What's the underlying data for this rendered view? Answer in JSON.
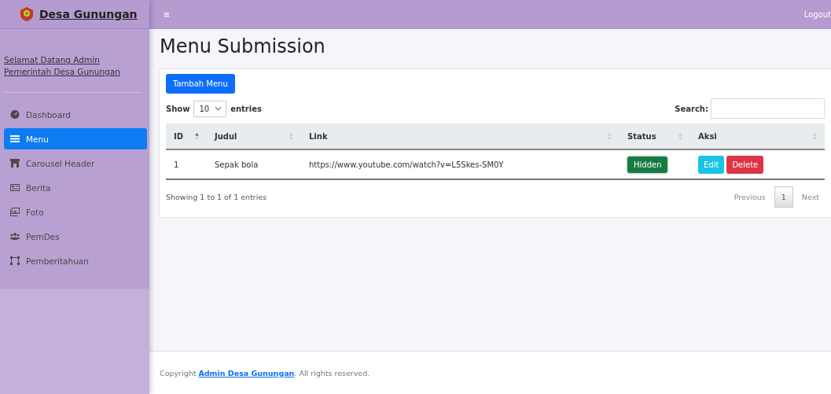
{
  "brand": {
    "title": "Desa Gunungan"
  },
  "topbar": {
    "menu_glyph": "≡",
    "logout": "Logout"
  },
  "sidebar": {
    "welcome": "Selamat Datang Admin Pemerintah Desa Gunungan",
    "items": [
      {
        "label": "Dashboard",
        "selected": false
      },
      {
        "label": "Menu",
        "selected": true
      },
      {
        "label": "Carousel Header",
        "selected": false
      },
      {
        "label": "Berita",
        "selected": false
      },
      {
        "label": "Foto",
        "selected": false
      },
      {
        "label": "PemDes",
        "selected": false
      },
      {
        "label": "Pemberitahuan",
        "selected": false
      }
    ]
  },
  "page": {
    "title": "Menu Submission"
  },
  "card": {
    "add_button": "Tambah Menu",
    "length": {
      "before": "Show",
      "value": "10",
      "after": "entries"
    },
    "search": {
      "label": "Search:"
    },
    "table": {
      "columns": [
        {
          "label": "ID",
          "sorted": true
        },
        {
          "label": "Judul",
          "sorted": false
        },
        {
          "label": "Link",
          "sorted": false
        },
        {
          "label": "Status",
          "sorted": false
        },
        {
          "label": "Aksi",
          "sorted": false
        }
      ],
      "rows": [
        {
          "id": "1",
          "judul": "Sepak bola",
          "link": "https://www.youtube.com/watch?v=L5Skes-SM0Y",
          "status": "Hidden",
          "actions": [
            {
              "label": "Edit",
              "kind": "edit"
            },
            {
              "label": "Delete",
              "kind": "delete"
            }
          ]
        }
      ]
    },
    "info": "Showing 1 to 1 of 1 entries",
    "pagination": [
      {
        "label": "Previous",
        "kind": "nav",
        "selected": false
      },
      {
        "label": "1",
        "kind": "page",
        "selected": true
      },
      {
        "label": "Next",
        "kind": "nav",
        "selected": false
      }
    ]
  },
  "footer": {
    "prefix": "Copyright ",
    "link": "Admin Desa Gunungan",
    "suffix": ". All rights reserved."
  }
}
